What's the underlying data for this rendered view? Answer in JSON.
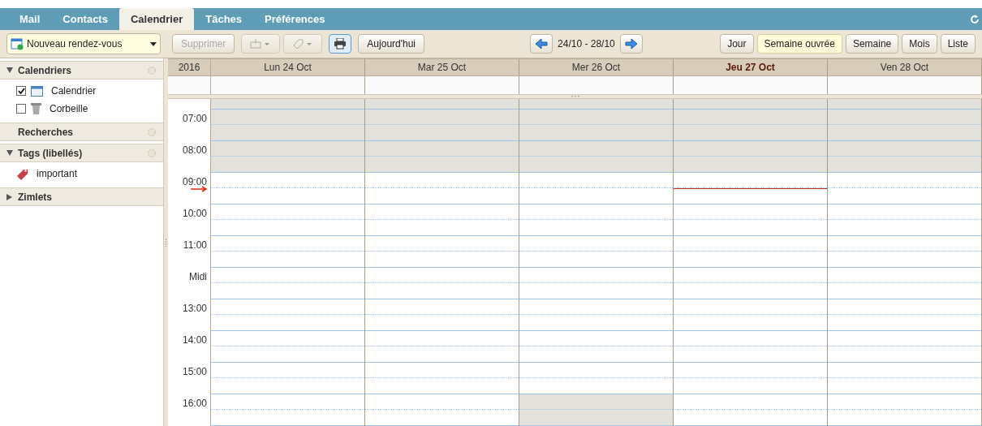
{
  "tabs": [
    {
      "label": "Mail",
      "selected": false
    },
    {
      "label": "Contacts",
      "selected": false
    },
    {
      "label": "Calendrier",
      "selected": true
    },
    {
      "label": "Tâches",
      "selected": false
    },
    {
      "label": "Préférences",
      "selected": false
    }
  ],
  "toolbar": {
    "new_button": "Nouveau rendez-vous",
    "delete_button": {
      "label": "Supprimer",
      "disabled": true
    },
    "today_button": "Aujourd'hui",
    "date_range": "24/10 - 28/10",
    "views": [
      {
        "label": "Jour",
        "selected": false
      },
      {
        "label": "Semaine ouvrée",
        "selected": true
      },
      {
        "label": "Semaine",
        "selected": false
      },
      {
        "label": "Mois",
        "selected": false
      },
      {
        "label": "Liste",
        "selected": false
      }
    ]
  },
  "sidebar": {
    "sections": [
      {
        "title": "Calendriers",
        "expanded": true,
        "items": [
          {
            "kind": "calendar",
            "label": "Calendrier",
            "checked": true
          },
          {
            "kind": "trash",
            "label": "Corbeille",
            "checked": false
          }
        ]
      },
      {
        "title": "Recherches"
      },
      {
        "title": "Tags (libellés)",
        "expanded": true,
        "items": [
          {
            "kind": "tag",
            "label": "important"
          }
        ]
      },
      {
        "title": "Zimlets",
        "expanded": false
      }
    ]
  },
  "calendar": {
    "year": "2016",
    "days": [
      {
        "label": "Lun 24 Oct",
        "today": false
      },
      {
        "label": "Mar 25 Oct",
        "today": false
      },
      {
        "label": "Mer 26 Oct",
        "today": false
      },
      {
        "label": "Jeu 27 Oct",
        "today": true
      },
      {
        "label": "Ven 28 Oct",
        "today": false
      }
    ],
    "hours": [
      {
        "shaded": [
          true,
          true,
          true,
          true,
          true
        ]
      },
      {
        "label": "07:00",
        "shaded": [
          true,
          true,
          true,
          true,
          true
        ]
      },
      {
        "label": "08:00",
        "shaded": [
          true,
          true,
          true,
          true,
          true
        ]
      },
      {
        "label": "09:00",
        "shaded": [
          false,
          false,
          false,
          false,
          false
        ],
        "now": true
      },
      {
        "label": "10:00",
        "shaded": [
          false,
          false,
          false,
          false,
          false
        ]
      },
      {
        "label": "11:00",
        "shaded": [
          false,
          false,
          false,
          false,
          false
        ]
      },
      {
        "label": "Midi",
        "shaded": [
          false,
          false,
          false,
          false,
          false
        ]
      },
      {
        "label": "13:00",
        "shaded": [
          false,
          false,
          false,
          false,
          false
        ]
      },
      {
        "label": "14:00",
        "shaded": [
          false,
          false,
          false,
          false,
          false
        ]
      },
      {
        "label": "15:00",
        "shaded": [
          false,
          false,
          false,
          false,
          false
        ]
      },
      {
        "label": "16:00",
        "shaded": [
          false,
          false,
          true,
          false,
          false
        ]
      }
    ]
  }
}
